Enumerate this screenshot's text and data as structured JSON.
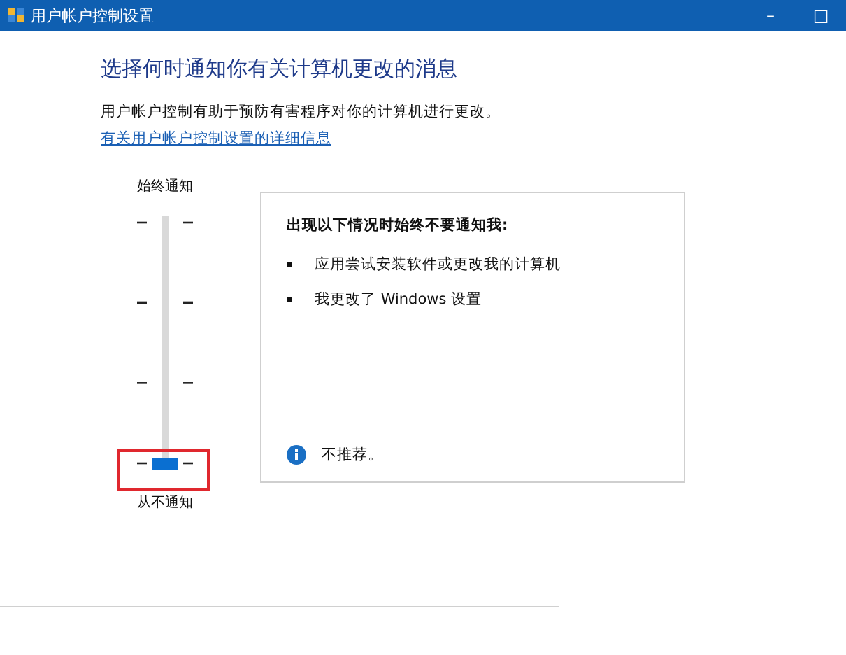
{
  "window": {
    "title": "用户帐户控制设置",
    "controls": [
      "–",
      "□"
    ]
  },
  "heading": "选择何时通知你有关计算机更改的消息",
  "description": "用户帐户控制有助于预防有害程序对你的计算机进行更改。",
  "link": "有关用户帐户控制设置的详细信息",
  "slider": {
    "top_label": "始终通知",
    "bottom_label": "从不通知",
    "level": 0
  },
  "panel": {
    "title": "出现以下情况时始终不要通知我:",
    "bullets": [
      "应用尝试安装软件或更改我的计算机",
      "我更改了 Windows 设置"
    ],
    "note": "不推荐。"
  }
}
